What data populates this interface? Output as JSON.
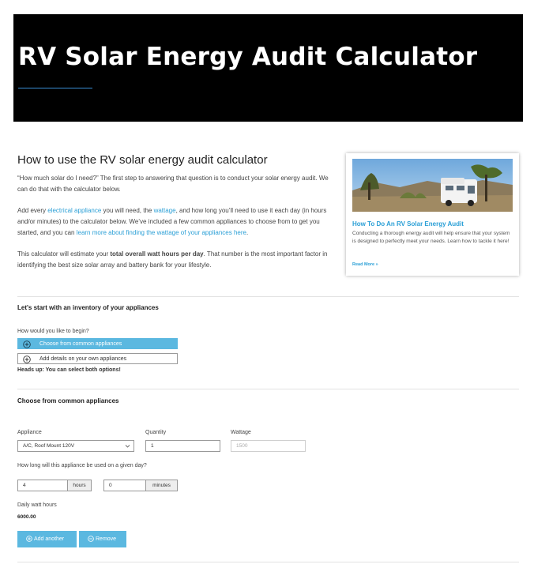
{
  "hero": {
    "title": "RV Solar Energy Audit Calculator"
  },
  "intro": {
    "heading": "How to use the RV solar energy audit calculator",
    "p1": "“How much solar do I need?” The first step to answering that question is to conduct your solar energy audit. We can do that with the calculator below.",
    "p2_a": "Add every ",
    "p2_link1": "electrical appliance",
    "p2_b": " you will need, the ",
    "p2_link2": "wattage",
    "p2_c": ", and how long you’ll need to use it each day (in hours and/or minutes) to the calculator below. We’ve included a few common appliances to choose from to get you started, and you can ",
    "p2_link3": "learn more about finding the wattage of your appliances here",
    "p2_d": ".",
    "p3_a": "This calculator will estimate your ",
    "p3_bold": "total overall watt hours per day",
    "p3_b": ". That number is the most important factor in identifying the best size solar array and battery bank for your lifestyle."
  },
  "card": {
    "title": "How To Do An RV Solar Energy Audit",
    "description": "Conducting a thorough energy audit will help ensure that your system is designed to perfectly meet your needs. Learn how to tackle it here!",
    "read_more": "Read More »"
  },
  "inventory": {
    "title": "Let's start with an inventory of your appliances",
    "question": "How would you like to begin?",
    "option_common": "Choose from common appliances",
    "option_own": "Add details on your own appliances",
    "note": "Heads up: You can select both options!"
  },
  "common": {
    "title": "Choose from common appliances",
    "appliance_label": "Appliance",
    "appliance_value": "A/C, Roof Mount 120V",
    "quantity_label": "Quantity",
    "quantity_value": "1",
    "wattage_label": "Wattage",
    "wattage_value": "1500",
    "usage_question": "How long will this appliance be used on a given day?",
    "hours_value": "4",
    "hours_suffix": "hours",
    "minutes_value": "0",
    "minutes_suffix": "minutes",
    "daily_label": "Daily watt hours",
    "daily_value": "6000.00",
    "add_label": "Add another",
    "remove_label": "Remove"
  },
  "colors": {
    "accent": "#5bb8e0",
    "link": "#2a9fd6",
    "hero_bg": "#000000"
  },
  "icons": {
    "add": "plus-circle-icon",
    "remove": "minus-circle-icon",
    "dropdown": "chevron-down-icon"
  }
}
